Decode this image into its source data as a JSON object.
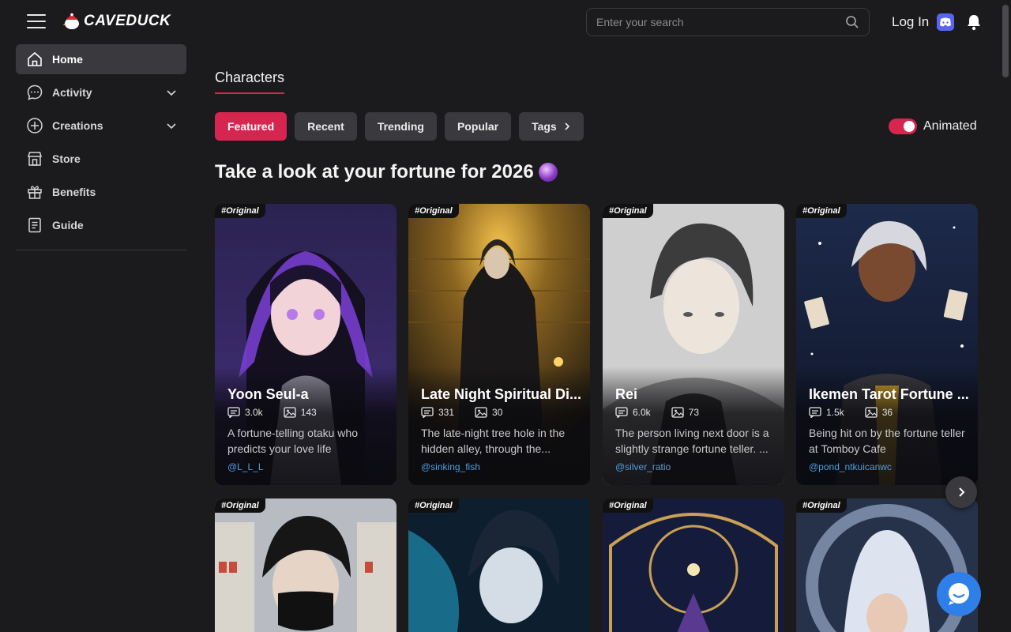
{
  "header": {
    "logo_text": "CAVEDUCK",
    "search_placeholder": "Enter your search",
    "login_label": "Log In"
  },
  "sidebar": {
    "items": [
      {
        "label": "Home",
        "icon": "home-icon",
        "active": true
      },
      {
        "label": "Activity",
        "icon": "chat-bubble-icon",
        "expandable": true
      },
      {
        "label": "Creations",
        "icon": "plus-circle-icon",
        "expandable": true
      },
      {
        "label": "Store",
        "icon": "store-icon"
      },
      {
        "label": "Benefits",
        "icon": "gift-icon"
      },
      {
        "label": "Guide",
        "icon": "document-icon"
      }
    ]
  },
  "main": {
    "section_tab": "Characters",
    "filters": [
      {
        "label": "Featured",
        "active": true
      },
      {
        "label": "Recent"
      },
      {
        "label": "Trending"
      },
      {
        "label": "Popular"
      },
      {
        "label": "Tags"
      }
    ],
    "animated_label": "Animated",
    "animated_on": true,
    "headline": "Take a look at your fortune for 2026",
    "cards": [
      {
        "tag": "#Original",
        "name": "Yoon Seul-a",
        "chats": "3.0k",
        "images": "143",
        "desc": "A fortune-telling otaku who predicts your love life",
        "author": "@L_L_L"
      },
      {
        "tag": "#Original",
        "name": "Late Night Spiritual Di...",
        "chats": "331",
        "images": "30",
        "desc": "The late-night tree hole in the hidden alley, through the...",
        "author": "@sinking_fish"
      },
      {
        "tag": "#Original",
        "name": "Rei",
        "chats": "6.0k",
        "images": "73",
        "desc": "The person living next door is a slightly strange fortune teller. ...",
        "author": "@silver_ratio"
      },
      {
        "tag": "#Original",
        "name": "Ikemen Tarot Fortune ...",
        "chats": "1.5k",
        "images": "36",
        "desc": "Being hit on by the fortune teller at Tomboy Cafe",
        "author": "@pond_ntkuicanwc"
      }
    ],
    "row2_tags": [
      "#Original",
      "#Original",
      "#Original",
      "#Original"
    ]
  },
  "colors": {
    "accent": "#d6264f",
    "background": "#1b1b1d",
    "chip": "#3a3a3e",
    "link": "#4f9ee0",
    "discord": "#5865f2",
    "chat_button": "#2f7fe8"
  }
}
